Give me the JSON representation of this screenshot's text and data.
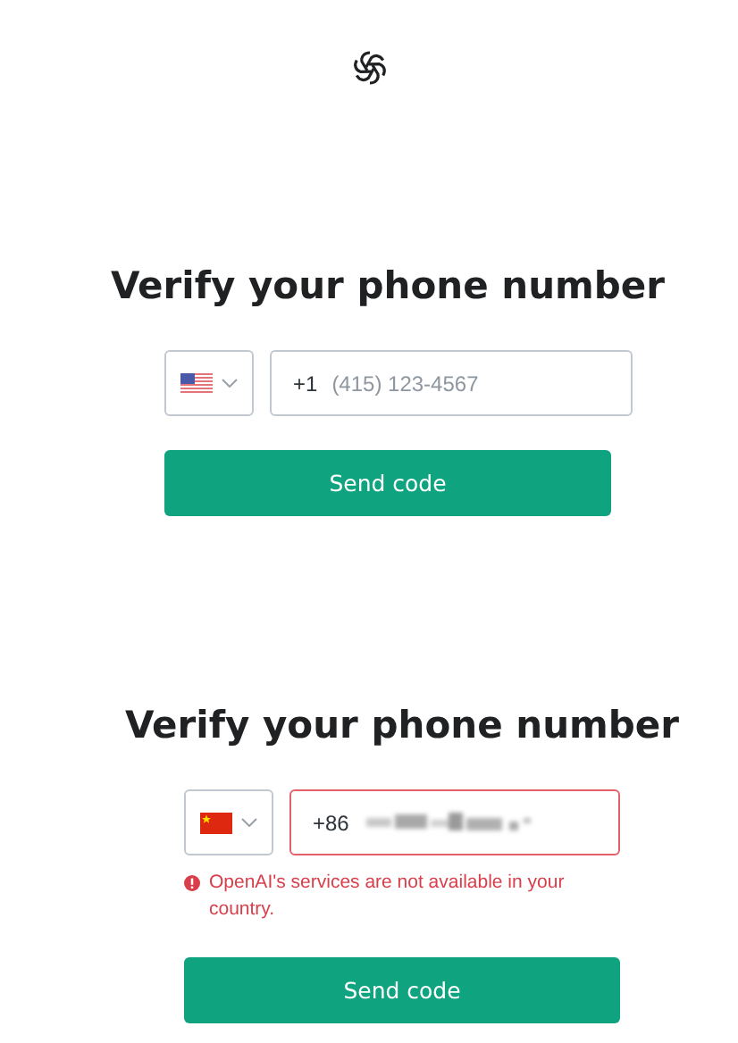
{
  "panels": [
    {
      "title": "Verify your phone number",
      "country": {
        "kind": "us"
      },
      "phone": {
        "prefix": "+1",
        "placeholder": "(415) 123-4567",
        "redacted": false,
        "invalid": false
      },
      "button": "Send code"
    },
    {
      "title": "Verify your phone number",
      "country": {
        "kind": "cn"
      },
      "phone": {
        "prefix": "+86",
        "redacted": true,
        "invalid": true
      },
      "error": "OpenAI's services are not available in your country.",
      "button": "Send code"
    }
  ]
}
